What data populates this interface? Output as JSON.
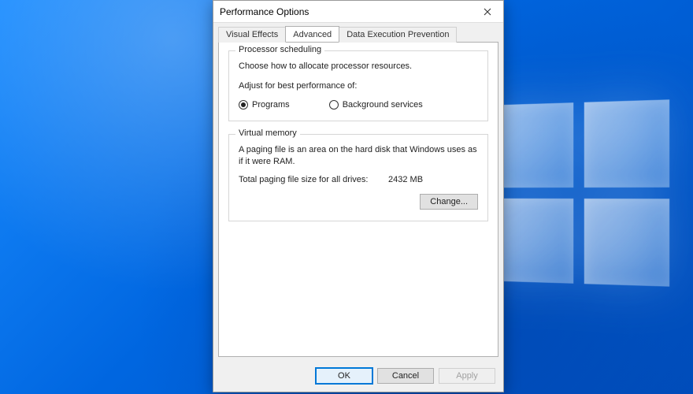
{
  "window": {
    "title": "Performance Options"
  },
  "tabs": {
    "visual_effects": "Visual Effects",
    "advanced": "Advanced",
    "dep": "Data Execution Prevention"
  },
  "processor_scheduling": {
    "legend": "Processor scheduling",
    "desc": "Choose how to allocate processor resources.",
    "adjust_label": "Adjust for best performance of:",
    "opt_programs": "Programs",
    "opt_background": "Background services"
  },
  "virtual_memory": {
    "legend": "Virtual memory",
    "desc": "A paging file is an area on the hard disk that Windows uses as if it were RAM.",
    "total_label": "Total paging file size for all drives:",
    "total_value": "2432 MB",
    "change_btn": "Change..."
  },
  "buttons": {
    "ok": "OK",
    "cancel": "Cancel",
    "apply": "Apply"
  }
}
